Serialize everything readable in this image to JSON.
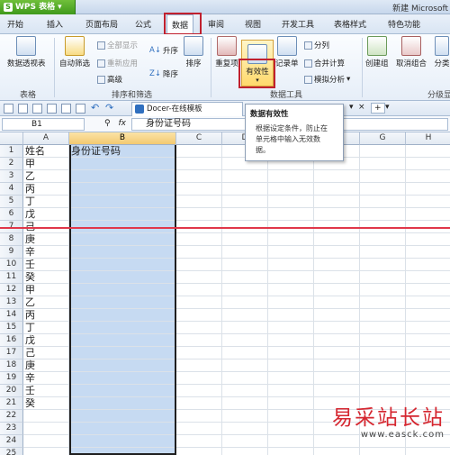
{
  "title_bar": {
    "app_button": "WPS 表格",
    "document_title": "新建 Microsoft"
  },
  "menu": {
    "items": [
      "开始",
      "插入",
      "页面布局",
      "公式",
      "数据",
      "审阅",
      "视图",
      "开发工具",
      "表格样式",
      "特色功能"
    ],
    "active_index": 4
  },
  "ribbon": {
    "pivot": {
      "label": "数据透视表"
    },
    "group_table": "表格",
    "autofilter": {
      "label": "自动筛选"
    },
    "filter_small": [
      "全部显示",
      "重新应用",
      "高级"
    ],
    "sort_asc": "升序",
    "sort_desc": "降序",
    "sort": "排序",
    "group_sort_filter": "排序和筛选",
    "duplicates": "重复项",
    "validation": "有效性",
    "record": "记录单",
    "split": "分列",
    "merge_calc": "合并计算",
    "simulate": "模拟分析",
    "group_data_tools": "数据工具",
    "create_group": "创建组",
    "ungroup": "取消组合",
    "subtotal": "分类",
    "group_outline": "分级显"
  },
  "tooltip": {
    "title": "数据有效性",
    "body": [
      "根据设定条件，防止在",
      "单元格中输入无效数",
      "据。"
    ]
  },
  "doc_tab": {
    "label": "Docer-在线模板",
    "close": "×",
    "add": "+",
    "arrow": "▾"
  },
  "formula_bar": {
    "cell_ref": "B1",
    "content": "身份证号码",
    "fx": "fx"
  },
  "sheet": {
    "columns": [
      "A",
      "B",
      "C",
      "D",
      "E",
      "F",
      "G",
      "H"
    ],
    "rows": [
      [
        "姓名",
        "身份证号码"
      ],
      [
        "甲",
        ""
      ],
      [
        "乙",
        ""
      ],
      [
        "丙",
        ""
      ],
      [
        "丁",
        ""
      ],
      [
        "戊",
        ""
      ],
      [
        "己",
        ""
      ],
      [
        "庚",
        ""
      ],
      [
        "辛",
        ""
      ],
      [
        "壬",
        ""
      ],
      [
        "癸",
        ""
      ],
      [
        "甲",
        ""
      ],
      [
        "乙",
        ""
      ],
      [
        "丙",
        ""
      ],
      [
        "丁",
        ""
      ],
      [
        "戊",
        ""
      ],
      [
        "己",
        ""
      ],
      [
        "庚",
        ""
      ],
      [
        "辛",
        ""
      ],
      [
        "壬",
        ""
      ],
      [
        "癸",
        ""
      ],
      [
        "",
        ""
      ],
      [
        "",
        ""
      ],
      [
        "",
        ""
      ],
      [
        "",
        ""
      ]
    ],
    "selected_column": "B",
    "selection_fill": "#c6daf2"
  },
  "watermark": {
    "line1": "易采站长站",
    "line2": "www.easck.com"
  },
  "colors": {
    "accent_red": "#c0202e",
    "wps_green": "#4aa324",
    "highlight": "#ffd96b"
  }
}
